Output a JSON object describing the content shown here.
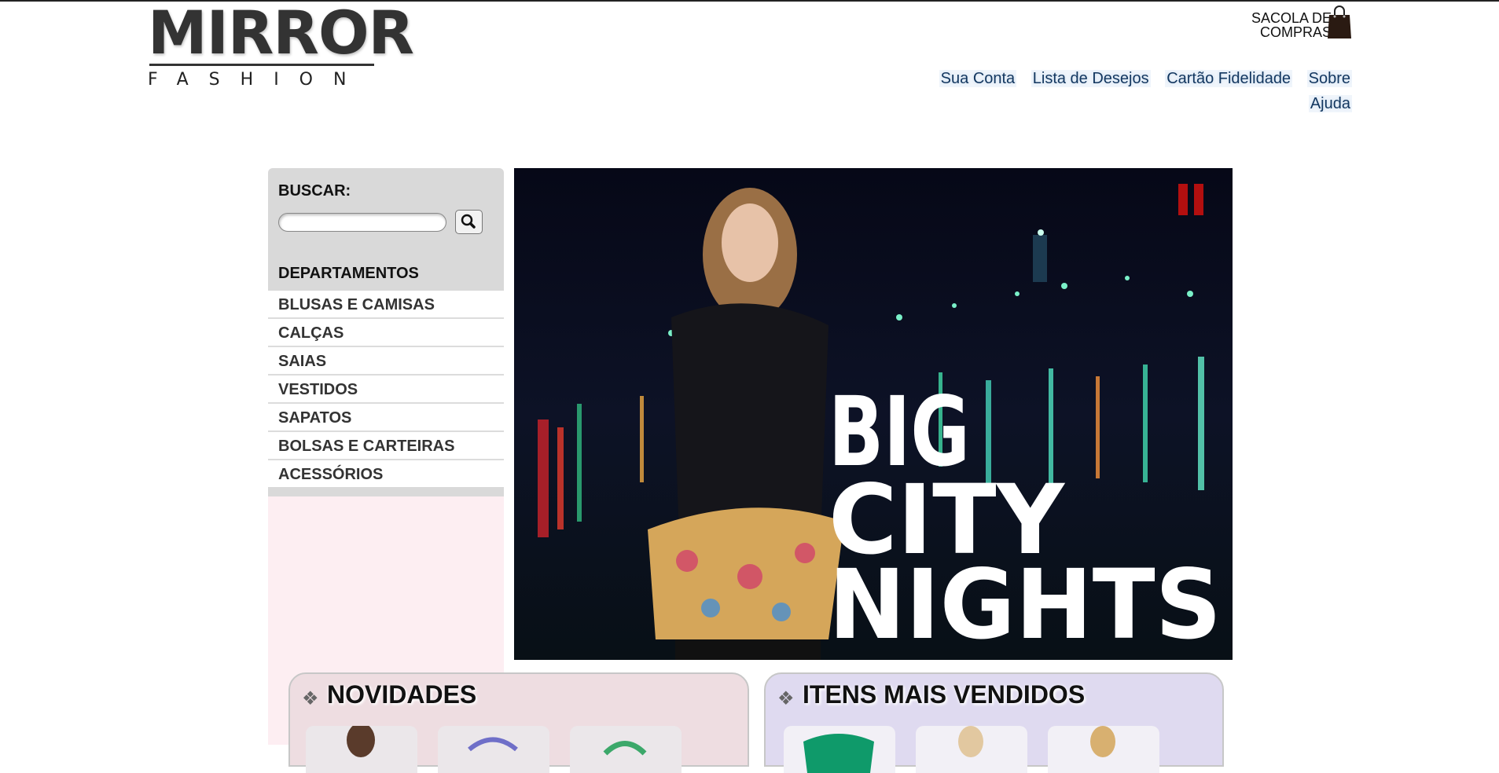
{
  "header": {
    "logo_text": "MIRROR",
    "logo_subtitle": "FASHION",
    "bag_label": "SACOLA DE COMPRAS",
    "nav_links": [
      "Sua Conta",
      "Lista de Desejos",
      "Cartão Fidelidade",
      "Sobre",
      "Ajuda"
    ]
  },
  "sidebar": {
    "search_label": "BUSCAR:",
    "search_value": "",
    "departments_title": "DEPARTAMENTOS",
    "departments": [
      "BLUSAS E CAMISAS",
      "CALÇAS",
      "SAIAS",
      "VESTIDOS",
      "SAPATOS",
      "BOLSAS E CARTEIRAS",
      "ACESSÓRIOS"
    ]
  },
  "banner": {
    "words": [
      "BIG",
      "CITY",
      "NIGHTS"
    ],
    "pause_color": "#b30f0f"
  },
  "sections": {
    "new_title": "NOVIDADES",
    "best_title": "ITENS MAIS VENDIDOS"
  },
  "colors": {
    "link": "#12365f",
    "sidebar_bg": "#fdeef2",
    "search_bg": "#d9d9d9",
    "new_box_bg": "#eedde1",
    "best_box_bg": "#dfdaf0"
  }
}
